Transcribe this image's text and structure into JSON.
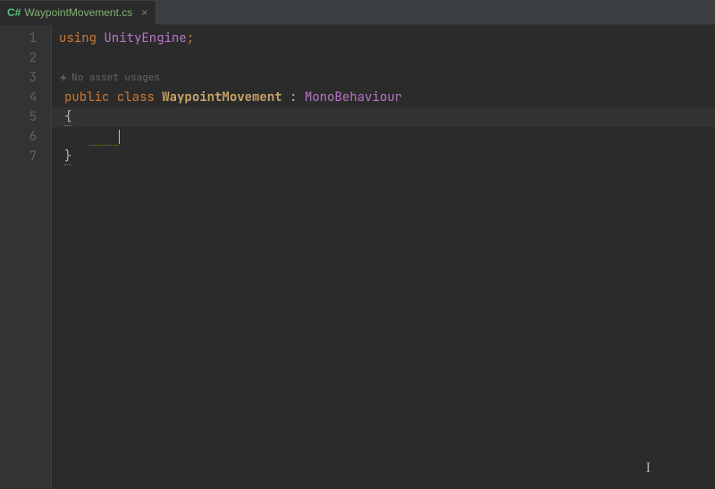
{
  "tab": {
    "icon_label": "C#",
    "filename": "WaypointMovement.cs"
  },
  "gutter": {
    "lines": [
      "1",
      "2",
      "3",
      "4",
      "5",
      "6",
      "7"
    ]
  },
  "code": {
    "using_kw": "using",
    "using_ns": "UnityEngine",
    "semicolon": ";",
    "hint_text": "No asset usages",
    "public_kw": "public",
    "class_kw": "class",
    "class_name": "WaypointMovement",
    "colon": " : ",
    "base_class": "MonoBehaviour",
    "open_brace": "{",
    "close_brace": "}"
  }
}
